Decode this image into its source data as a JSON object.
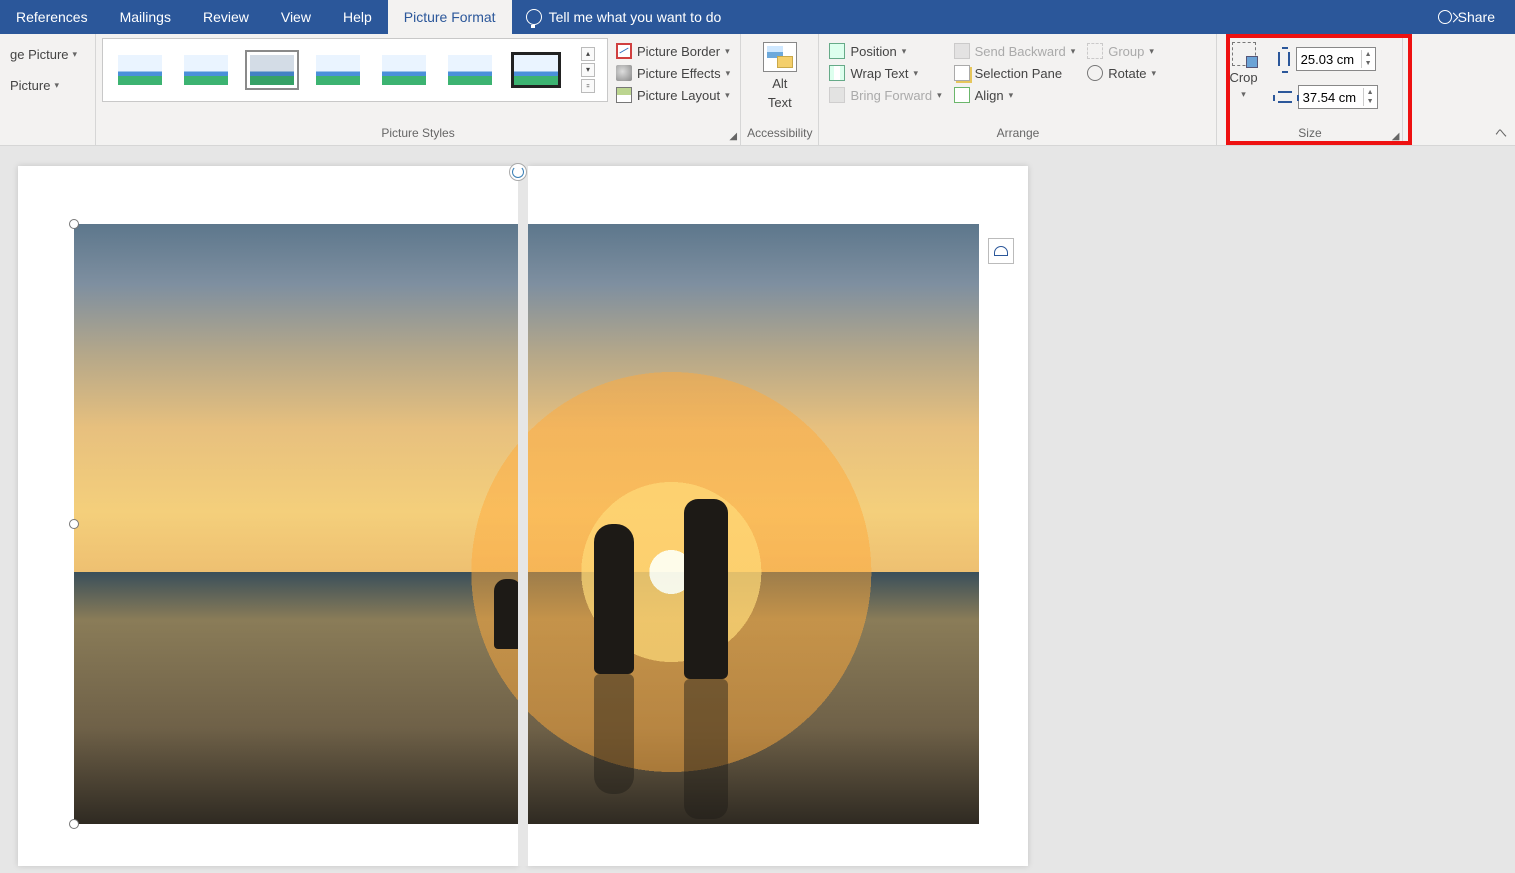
{
  "tabs": {
    "references": "References",
    "mailings": "Mailings",
    "review": "Review",
    "view": "View",
    "help": "Help",
    "picture_format": "Picture Format",
    "tell_me": "Tell me what you want to do"
  },
  "share": "Share",
  "left_group": {
    "change_picture": "ge Picture",
    "reset_picture": "Picture"
  },
  "picture_styles": {
    "label": "Picture Styles",
    "border": "Picture Border",
    "effects": "Picture Effects",
    "layout": "Picture Layout"
  },
  "accessibility": {
    "alt_text_line1": "Alt",
    "alt_text_line2": "Text",
    "label": "Accessibility"
  },
  "arrange": {
    "position": "Position",
    "wrap_text": "Wrap Text",
    "bring_forward": "Bring Forward",
    "send_backward": "Send Backward",
    "selection_pane": "Selection Pane",
    "align": "Align",
    "group": "Group",
    "rotate": "Rotate",
    "label": "Arrange"
  },
  "size": {
    "crop": "Crop",
    "height": "25.03 cm",
    "width": "37.54 cm",
    "label": "Size"
  }
}
